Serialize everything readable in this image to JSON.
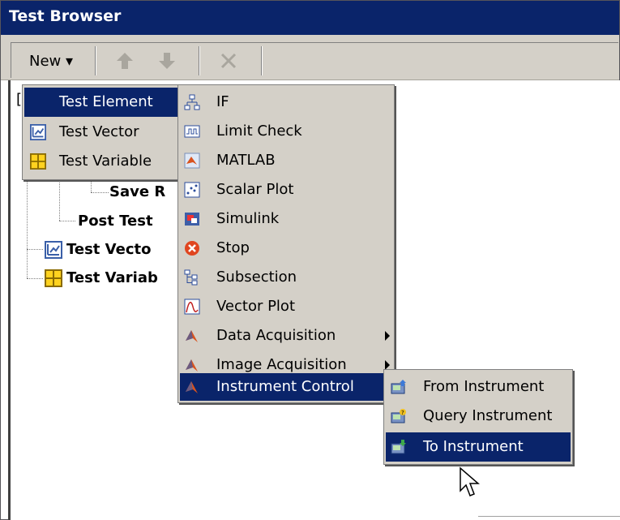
{
  "window": {
    "title": "Test Browser"
  },
  "toolbar": {
    "new_label": "New ▾"
  },
  "tree": {
    "partial_bracket": "[",
    "nodes": [
      "Save R",
      "Post Test",
      "Test Vecto",
      "Test Variab"
    ]
  },
  "new_menu": {
    "items": [
      {
        "label": "Test Element",
        "icon": "none",
        "has_submenu": true
      },
      {
        "label": "Test Vector",
        "icon": "test-vector-icon"
      },
      {
        "label": "Test Variable",
        "icon": "test-variable-icon"
      }
    ]
  },
  "element_menu": {
    "items": [
      {
        "label": "IF",
        "icon": "if-icon"
      },
      {
        "label": "Limit Check",
        "icon": "limit-check-icon"
      },
      {
        "label": "MATLAB",
        "icon": "matlab-icon"
      },
      {
        "label": "Scalar Plot",
        "icon": "scalar-plot-icon"
      },
      {
        "label": "Simulink",
        "icon": "simulink-icon"
      },
      {
        "label": "Stop",
        "icon": "stop-icon"
      },
      {
        "label": "Subsection",
        "icon": "subsection-icon"
      },
      {
        "label": "Vector Plot",
        "icon": "vector-plot-icon"
      },
      {
        "label": "Data Acquisition",
        "icon": "toolbox-icon",
        "has_submenu": true
      },
      {
        "label": "Image Acquisition",
        "icon": "toolbox-icon",
        "has_submenu": true
      },
      {
        "label": "Instrument Control",
        "icon": "toolbox-icon",
        "has_submenu": true
      }
    ]
  },
  "instrument_menu": {
    "items": [
      {
        "label": "From Instrument",
        "icon": "from-instrument-icon"
      },
      {
        "label": "Query Instrument",
        "icon": "query-instrument-icon"
      },
      {
        "label": "To Instrument",
        "icon": "to-instrument-icon"
      }
    ]
  },
  "colors": {
    "selection": "#0a246a",
    "menu_bg": "#d4d0c8",
    "title_bg": "#0a246a"
  }
}
